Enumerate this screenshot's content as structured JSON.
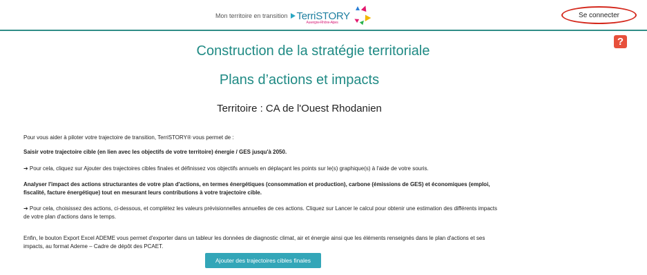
{
  "header": {
    "tagline": "Mon territoire en transition",
    "brand_name": "TerriSTORY",
    "brand_sub": "Auvergne-Rhône-Alpes",
    "login_label": "Se connecter",
    "help_label": "?"
  },
  "main": {
    "title": "Construction de la stratégie territoriale",
    "subtitle": "Plans d’actions et impacts",
    "territory": "Territoire : CA de l'Ouest Rhodanien",
    "paragraphs": [
      "Pour vous aider à piloter votre trajectoire de transition, TerriSTORY® vous permet de :",
      "Saisir votre trajectoire cible (en lien avec les objectifs de votre territoire) énergie / GES jusqu'à 2050.",
      "➔ Pour cela, cliquez sur Ajouter des trajectoires cibles finales et définissez vos objectifs annuels en déplaçant les points sur le(s) graphique(s) à l'aide de votre souris.",
      "Analyser l'impact des actions structurantes de votre plan d'actions, en termes énergétiques (consommation et production), carbone (émissions de GES) et économiques (emploi, fiscalité, facture énergétique) tout en mesurant leurs contributions à votre trajectoire cible.",
      "➔ Pour cela, choisissez des actions, ci-dessous, et complétez les valeurs prévisionnelles annuelles de ces actions. Cliquez sur Lancer le calcul pour obtenir une estimation des différents impacts de votre plan d'actions dans le temps.",
      "Enfin, le bouton Export Excel ADEME vous permet d'exporter dans un tableur les données de diagnostic climat, air et énergie ainsi que les éléments renseignés dans le plan d'actions et ses impacts, au format Ademe – Cadre de dépôt des PCAET."
    ],
    "cta_label": "Ajouter des trajectoires cibles finales"
  },
  "colors": {
    "accent": "#1f8a84",
    "button": "#33a6b8",
    "help": "#e7503b",
    "highlight_ring": "#d4281c"
  }
}
